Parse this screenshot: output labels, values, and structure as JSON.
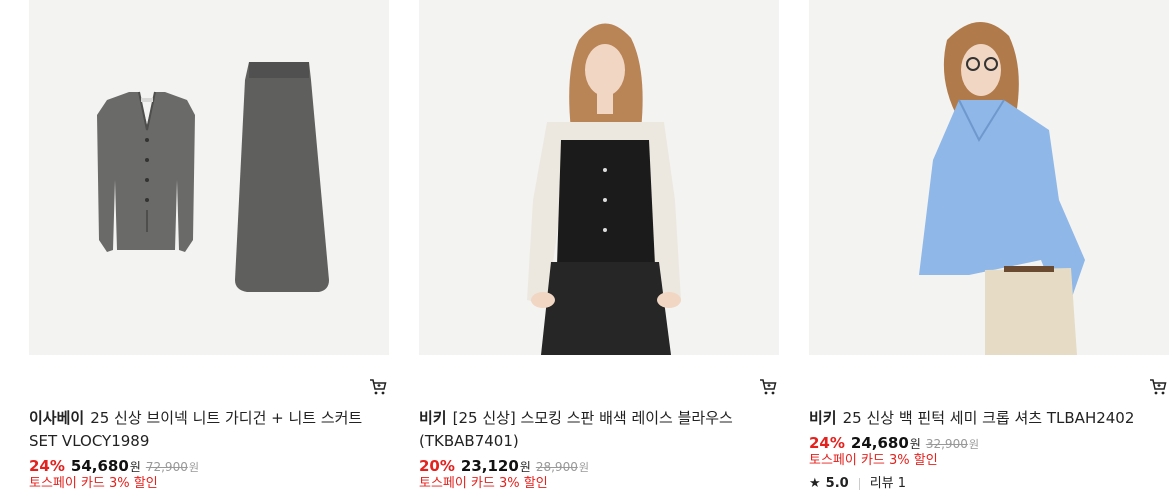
{
  "products": [
    {
      "brand": "이사베이",
      "title": "25 신상 브이넥 니트 가디건 + 니트 스커트 SET VLOCY1989",
      "discount": "24%",
      "price": "54,680",
      "currency": "원",
      "original_price": "72,900",
      "original_currency": "원",
      "promo": "토스페이 카드 3% 할인",
      "image_icon": "knit-cardigan-skirt-set-image"
    },
    {
      "brand": "비키",
      "title": "[25 신상] 스모킹 스판 배색 레이스 블라우스 (TKBAB7401)",
      "discount": "20%",
      "price": "23,120",
      "currency": "원",
      "original_price": "28,900",
      "original_currency": "원",
      "promo": "토스페이 카드 3% 할인",
      "image_icon": "lace-blouse-model-image"
    },
    {
      "brand": "비키",
      "title": "25 신상 백 핀턱 세미 크롭 셔츠 TLBAH2402",
      "discount": "24%",
      "price": "24,680",
      "currency": "원",
      "original_price": "32,900",
      "original_currency": "원",
      "promo": "토스페이 카드 3% 할인",
      "rating_star": "★",
      "rating": "5.0",
      "review_label": "리뷰 1",
      "image_icon": "blue-shirt-model-image"
    }
  ],
  "colors": {
    "discount": "#e5211d",
    "image_bg": "#f3f3f2",
    "strike": "#999999"
  }
}
